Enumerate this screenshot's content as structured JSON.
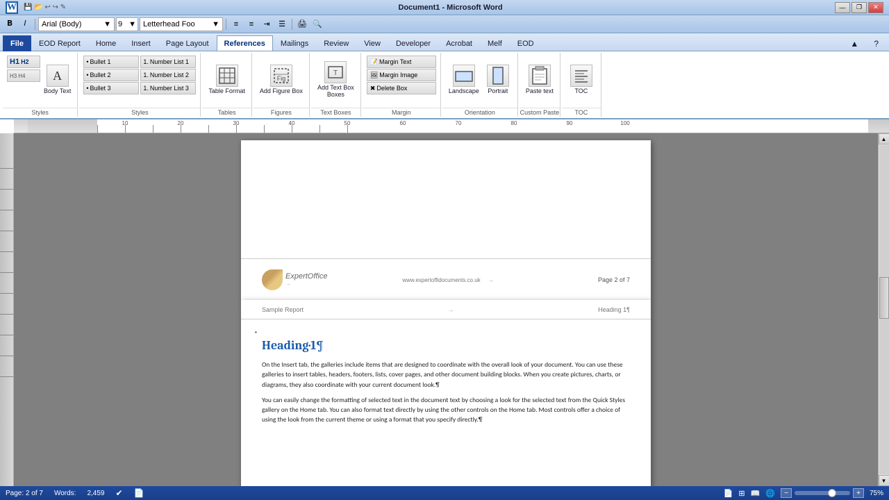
{
  "titlebar": {
    "title": "Document1 - Microsoft Word",
    "min_label": "—",
    "restore_label": "❐",
    "close_label": "✕",
    "min2_label": "—",
    "restore2_label": "❐",
    "close2_label": "✕"
  },
  "quickaccess": {
    "font": "Arial (Body)",
    "size": "9",
    "style": "Letterhead Foo"
  },
  "tabs": {
    "file": "File",
    "eod_report": "EOD Report",
    "home": "Home",
    "insert": "Insert",
    "page_layout": "Page Layout",
    "references": "References",
    "mailings": "Mailings",
    "review": "Review",
    "view": "View",
    "developer": "Developer",
    "acrobat": "Acrobat",
    "melf": "Melf",
    "eod": "EOD"
  },
  "ribbon": {
    "groups": {
      "styles": {
        "label": "Styles",
        "h1": "H1",
        "h2": "H2",
        "h3": "H3",
        "h4": "H4",
        "body_text_label": "Body Text",
        "body_icon": "A"
      },
      "bullets": {
        "label": "Styles",
        "bullet1": "Bullet 1",
        "bullet2": "Bullet 2",
        "bullet3": "Bullet 3",
        "num1": "Number List 1",
        "num2": "Number List 2",
        "num3": "Number List 3"
      },
      "tables": {
        "label": "Tables",
        "table_format": "Table Format"
      },
      "figures": {
        "label": "Figures",
        "add_figure_box": "Add Figure Box"
      },
      "textboxes": {
        "label": "Text Boxes",
        "add_text_box": "Add Text Box",
        "boxes_label": "Boxes"
      },
      "margin": {
        "label": "Margin",
        "margin_text": "Margin Text",
        "margin_image": "Margin Image",
        "delete_box": "Delete Box"
      },
      "orientation": {
        "label": "Orientation",
        "landscape": "Landscape",
        "portrait": "Portrait"
      },
      "custom_paste": {
        "label": "Custom Paste",
        "paste_text": "Paste text"
      },
      "toc": {
        "label": "TOC",
        "toc_btn": "TOC"
      }
    }
  },
  "document": {
    "page1_footer": {
      "left_text": "ExpertOffice",
      "center_text": "www.expertoffidocuments.co.uk",
      "right_text": "Page 2 of 7"
    },
    "page2_header": {
      "left_text": "Sample Report",
      "right_text": "Heading 1¶"
    },
    "heading": "Heading·1¶",
    "body1": "On the Insert tab, the galleries include items that are designed to coordinate with the overall look of your document. You can use these galleries to insert tables, headers, footers, lists, cover pages, and other document building blocks. When you create pictures, charts, or diagrams, they also coordinate with your current document look.¶",
    "body2": "You can easily change the formatting of selected text in the document text by choosing a look for the selected text from the Quick Styles gallery on the Home tab. You can also format text directly by using the other controls on the Home tab. Most controls offer a choice of using the look from the current theme or using a format that you specify directly.¶"
  },
  "statusbar": {
    "page_info": "Page: 2 of 7",
    "words_label": "Words:",
    "words_count": "2,459",
    "zoom_level": "75%"
  }
}
